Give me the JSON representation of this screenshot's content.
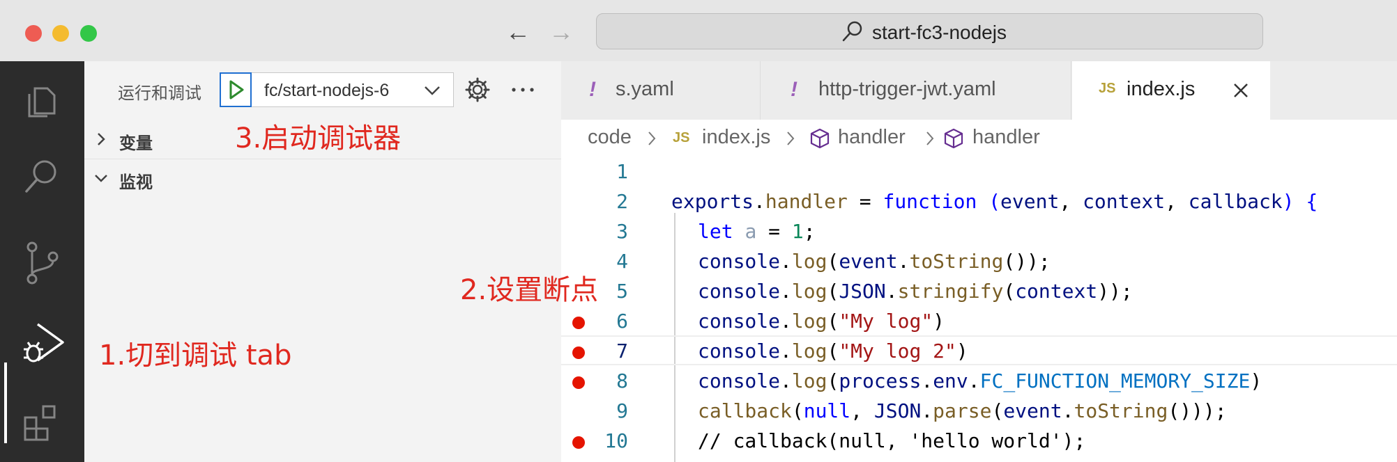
{
  "titlebar": {
    "search_text": "start-fc3-nodejs"
  },
  "sidebar": {
    "title": "运行和调试",
    "config": "fc/start-nodejs-6",
    "sections": [
      "变量",
      "监视"
    ]
  },
  "tabs": [
    {
      "icon": "!",
      "label": "s.yaml"
    },
    {
      "icon": "!",
      "label": "http-trigger-jwt.yaml"
    },
    {
      "icon": "JS",
      "label": "index.js"
    }
  ],
  "breadcrumb": [
    {
      "label": "code"
    },
    {
      "icon": "JS",
      "label": "index.js"
    },
    {
      "label": "handler"
    },
    {
      "label": "handler"
    }
  ],
  "editor": {
    "line_numbers": [
      "1",
      "2",
      "3",
      "4",
      "5",
      "6",
      "7",
      "8",
      "9",
      "10"
    ]
  },
  "annotations": {
    "step1": "1.切到调试 tab",
    "step2": "2.设置断点",
    "step3": "3.启动调试器"
  },
  "colors": {
    "annotation": "#e0281f",
    "breakpoint": "#e51400",
    "run_button_border": "#1f6fd1"
  }
}
